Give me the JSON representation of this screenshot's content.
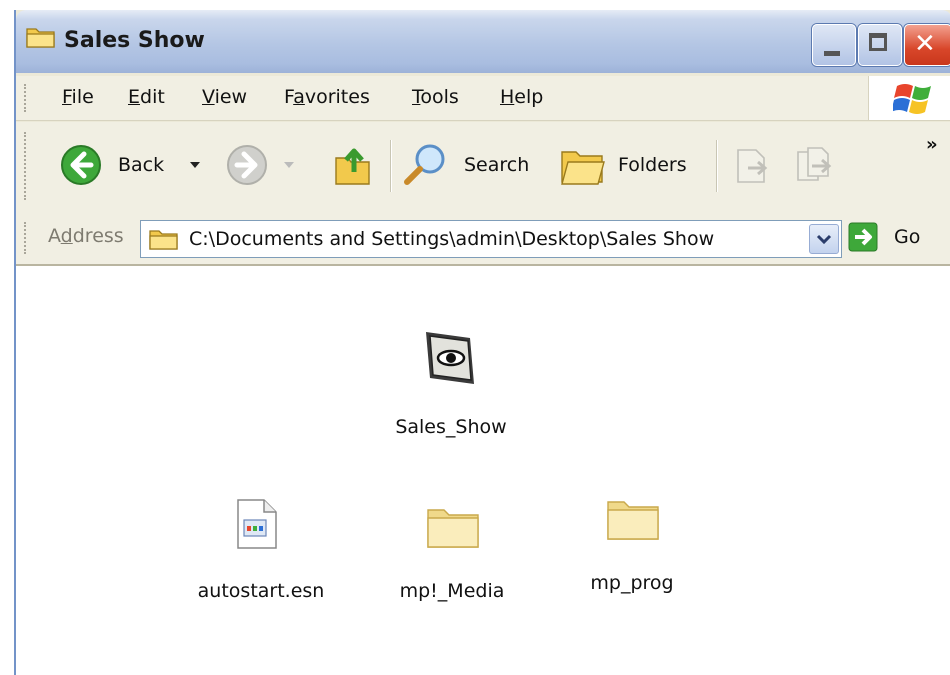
{
  "window": {
    "title": "Sales Show",
    "title_icon": "folder-icon",
    "controls": [
      "minimize-icon",
      "maximize-icon",
      "close-icon"
    ]
  },
  "menu": {
    "items": [
      {
        "label": "File",
        "accel": "F",
        "rest": "ile"
      },
      {
        "label": "Edit",
        "accel": "E",
        "rest": "dit"
      },
      {
        "label": "View",
        "accel": "V",
        "rest": "iew"
      },
      {
        "label": "Favorites",
        "pre": "F",
        "accel": "a",
        "rest": "vorites"
      },
      {
        "label": "Tools",
        "accel": "T",
        "rest": "ools"
      },
      {
        "label": "Help",
        "accel": "H",
        "rest": "elp"
      }
    ]
  },
  "toolbar": {
    "back_label": "Back",
    "search_label": "Search",
    "folders_label": "Folders",
    "overflow": "»"
  },
  "address": {
    "label_pre": "A",
    "label_accel": "d",
    "label_rest": "dress",
    "value": "C:\\Documents and Settings\\admin\\Desktop\\Sales Show",
    "go_label": "Go"
  },
  "files": [
    {
      "name": "Sales_Show",
      "icon": "slideshow-app-icon"
    },
    {
      "name": "autostart.esn",
      "icon": "document-icon"
    },
    {
      "name": "mp!_Media",
      "icon": "folder-icon"
    },
    {
      "name": "mp_prog",
      "icon": "folder-icon"
    }
  ],
  "colors": {
    "titlebar": "#b4c6e4",
    "close_button": "#d8462a",
    "toolbar_bg": "#f1efe3",
    "folder_yellow": "#f6e7a8"
  }
}
